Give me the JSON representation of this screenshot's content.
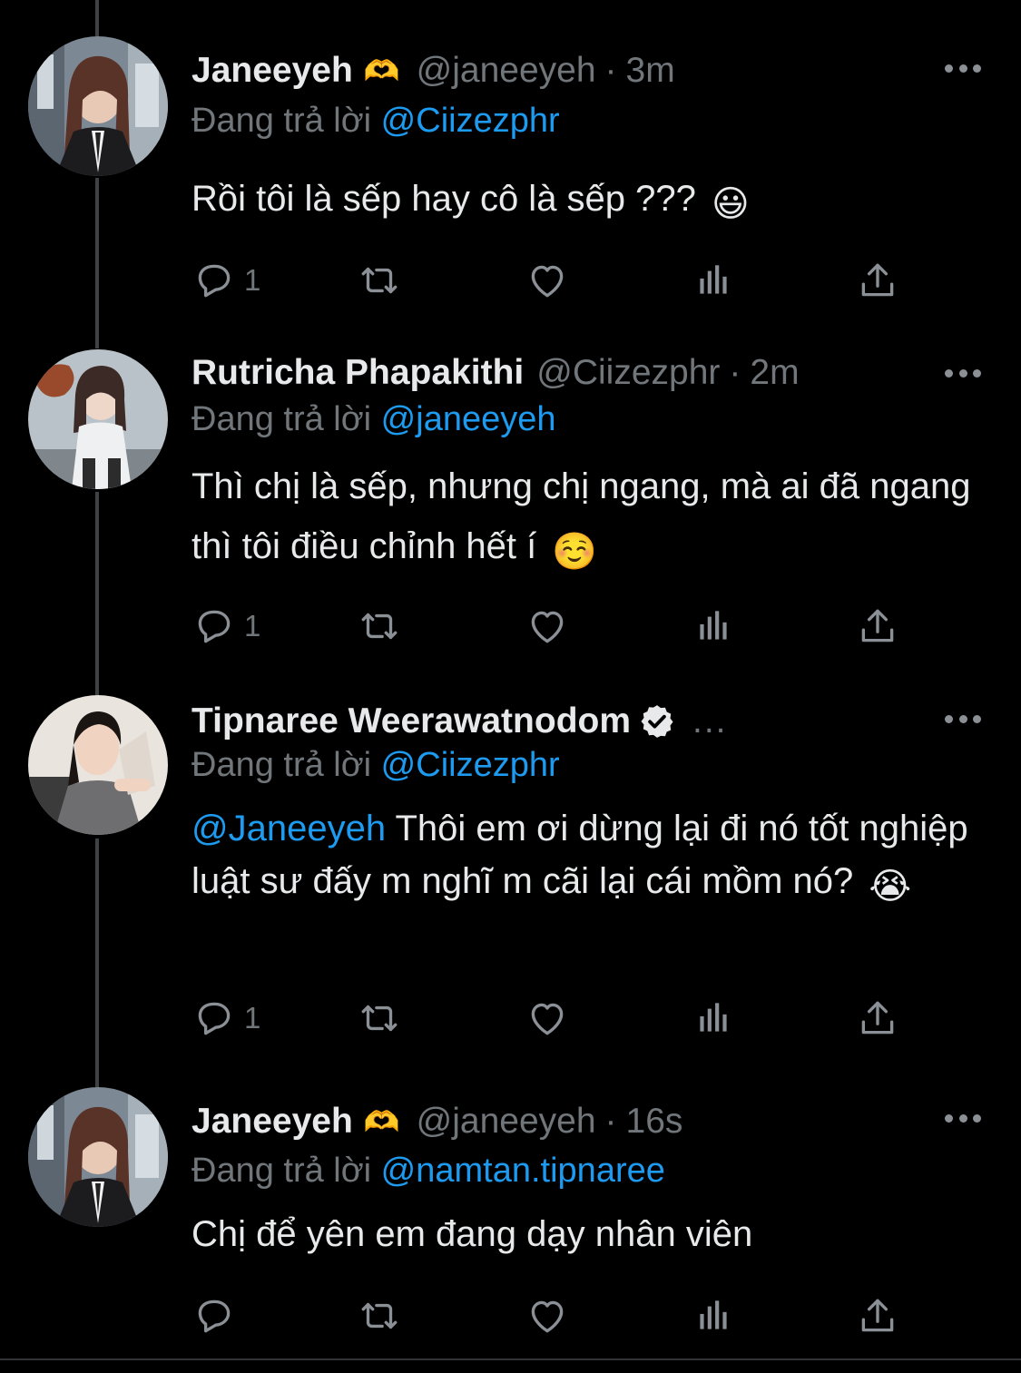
{
  "tweets": [
    {
      "name": "Janeeyeh",
      "name_emoji": "🫶",
      "handle": "@janeeyeh",
      "time": "3m",
      "reply_prefix": "Đang trả lời",
      "reply_to": "@Ciizezphr",
      "text": "Rồi tôi là sếp hay cô là sếp ???",
      "text_mention": "",
      "trailing_emoji": "😃",
      "reply_count": "1"
    },
    {
      "name": "Rutricha Phapakithi",
      "handle": "@Ciizezphr",
      "time": "2m",
      "reply_prefix": "Đang trả lời",
      "reply_to": "@janeeyeh",
      "text": "Thì chị là sếp, nhưng chị ngang, mà ai đã ngang thì tôi điều chỉnh hết í",
      "trailing_emoji": "☺️",
      "reply_count": "1"
    },
    {
      "name": "Tipnaree Weerawatnodom",
      "verified": true,
      "truncated": "...",
      "reply_prefix": "Đang trả lời",
      "reply_to": "@Ciizezphr",
      "text_mention": "@Janeeyeh",
      "text": " Thôi em ơi dừng lại đi nó tốt nghiệp luật sư đấy m nghĩ m cãi lại cái mồm nó?",
      "trailing_emoji": "😭",
      "reply_count": "1"
    },
    {
      "name": "Janeeyeh",
      "name_emoji": "🫶",
      "handle": "@janeeyeh",
      "time": "16s",
      "reply_prefix": "Đang trả lời",
      "reply_to": "@namtan.tipnaree",
      "text": "Chị để yên em đang dạy nhân viên",
      "reply_count": ""
    }
  ],
  "icons": {
    "reply": "comment-bubble-icon",
    "retweet": "retweet-icon",
    "like": "heart-icon",
    "views": "analytics-bars-icon",
    "share": "share-upload-icon",
    "more": "more-horizontal-icon",
    "verified": "verified-badge-icon"
  },
  "colors": {
    "background": "#000000",
    "text": "#e7e9ea",
    "secondary": "#71767b",
    "link": "#1d9bf0",
    "thread_line": "#3d4247"
  }
}
